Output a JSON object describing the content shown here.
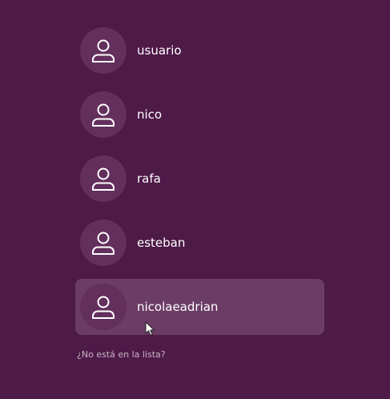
{
  "users": [
    {
      "name": "usuario",
      "selected": false
    },
    {
      "name": "nico",
      "selected": false
    },
    {
      "name": "rafa",
      "selected": false
    },
    {
      "name": "esteban",
      "selected": false
    },
    {
      "name": "nicolaeadrian",
      "selected": true
    }
  ],
  "not_listed_label": "¿No está en la lista?",
  "colors": {
    "background": "#4e1a48",
    "selected_row": "#6b3c66",
    "avatar_bg": "#632f5c",
    "text": "#ffffff",
    "secondary_text": "#c9b2c4"
  },
  "icons": {
    "avatar": "user-icon",
    "pointer": "mouse-pointer-icon"
  }
}
